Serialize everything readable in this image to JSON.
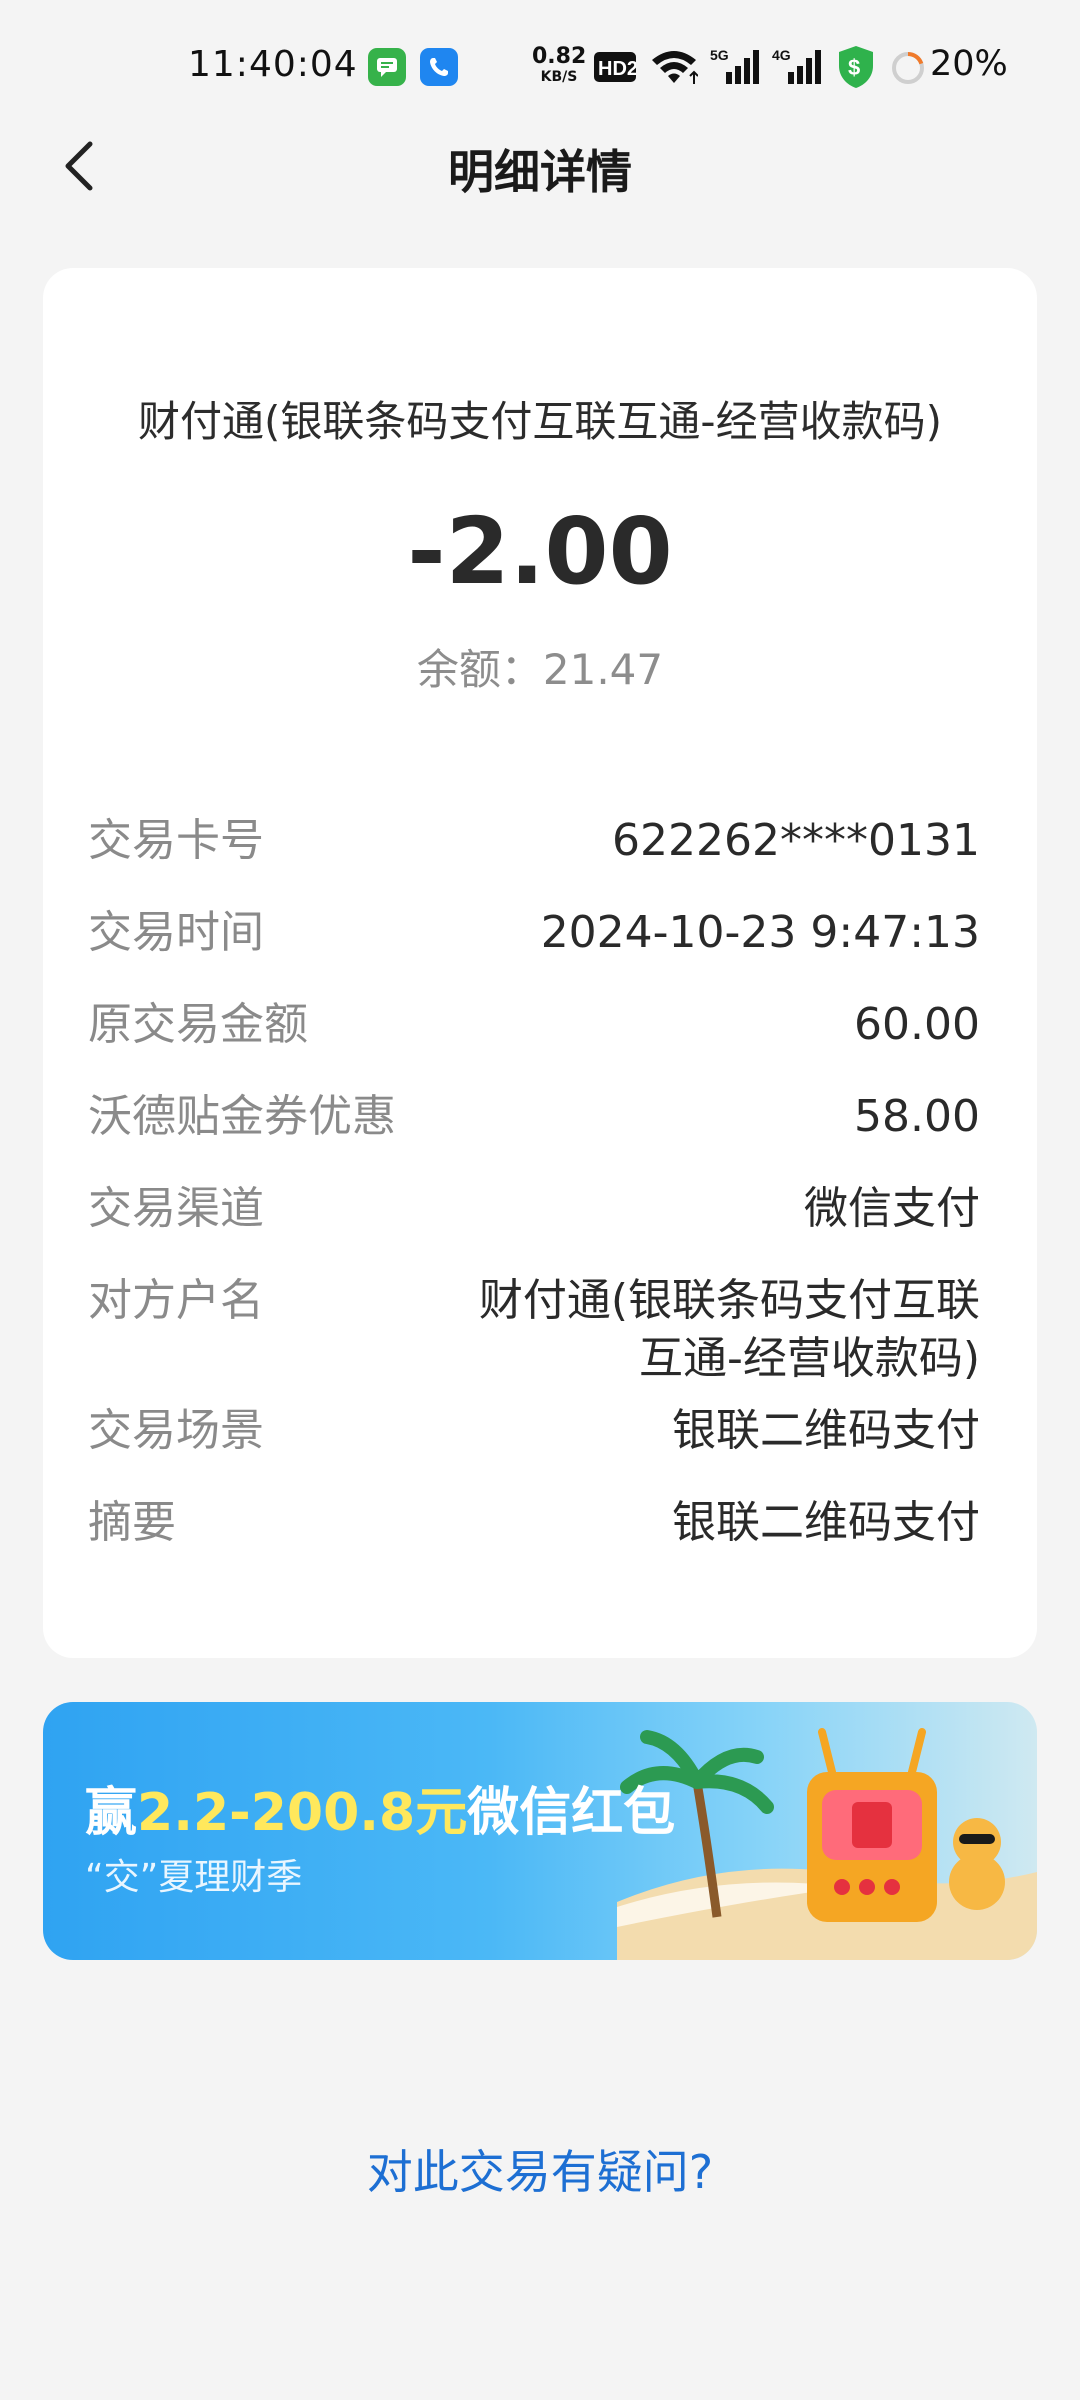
{
  "status_bar": {
    "time": "11:40:04",
    "net_speed_value": "0.82",
    "net_speed_unit": "KB/S",
    "hd_label": "HD2",
    "signal_1": "5G",
    "signal_2": "4G",
    "battery_percent": "20%",
    "battery_level": 0.2,
    "icons": [
      "message-app-icon",
      "phone-app-icon",
      "hd-icon",
      "wifi-icon",
      "signal-5g-icon",
      "signal-4g-icon",
      "security-shield-icon",
      "battery-ring-icon"
    ]
  },
  "header": {
    "title": "明细详情",
    "back_icon": "chevron-left-icon"
  },
  "transaction": {
    "merchant": "财付通(银联条码支付互联互通-经营收款码)",
    "amount": "-2.00",
    "balance_label": "余额：",
    "balance_value": "21.47",
    "details": [
      {
        "label": "交易卡号",
        "value": "622262****0131"
      },
      {
        "label": "交易时间",
        "value": "2024-10-23 9:47:13"
      },
      {
        "label": "原交易金额",
        "value": "60.00"
      },
      {
        "label": "沃德贴金券优惠",
        "value": "58.00"
      },
      {
        "label": "交易渠道",
        "value": "微信支付"
      },
      {
        "label": "对方户名",
        "value": "财付通(银联条码支付互联互通-经营收款码)"
      },
      {
        "label": "交易场景",
        "value": "银联二维码支付"
      },
      {
        "label": "摘要",
        "value": "银联二维码支付"
      }
    ]
  },
  "promo": {
    "title_prefix": "赢",
    "title_highlight": "2.2-200.8元",
    "title_suffix": "微信红包",
    "subtitle": "“交”夏理财季",
    "colors": {
      "highlight": "#ffe85c",
      "background_start": "#2fa3f2",
      "background_end": "#cfe9f1"
    }
  },
  "footer": {
    "dispute_link": "对此交易有疑问?"
  },
  "colors": {
    "page_bg": "#f4f4f4",
    "card_bg": "#ffffff",
    "label": "#8a8a8a",
    "value": "#2a2a2a",
    "link": "#1d6fd3"
  }
}
